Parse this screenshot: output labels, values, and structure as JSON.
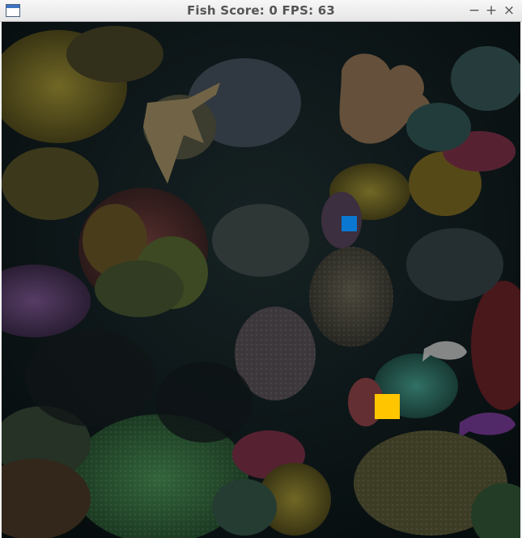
{
  "window": {
    "title": "Fish Score: 0 FPS: 63",
    "controls": {
      "minimize": "−",
      "maximize": "+",
      "close": "×"
    }
  },
  "game": {
    "scene": "coral-reef",
    "entities": {
      "player": {
        "color": "#ffc600"
      },
      "fish": {
        "color": "#0a78d0"
      }
    }
  },
  "colors": {
    "titlebar": "#ececec",
    "background": "#0b1416"
  }
}
